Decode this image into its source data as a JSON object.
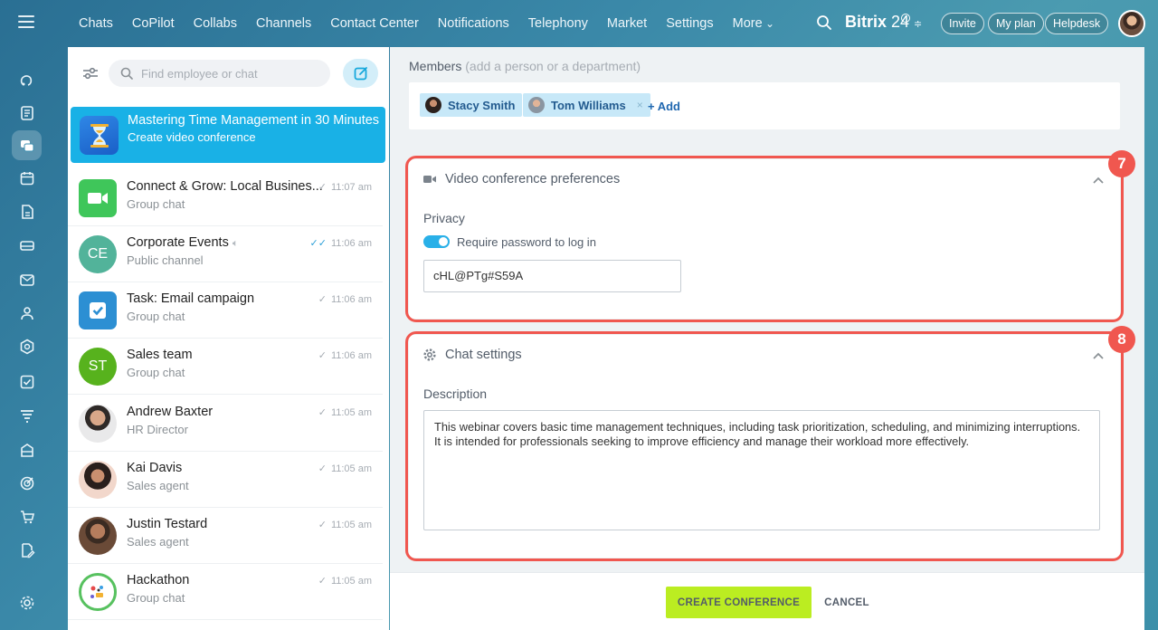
{
  "topbar": {
    "nav": [
      "Chats",
      "CoPilot",
      "Collabs",
      "Channels",
      "Contact Center",
      "Notifications",
      "Telephony",
      "Market",
      "Settings"
    ],
    "more_label": "More",
    "brand_name": "Bitrix",
    "brand_num": " 24",
    "invite_label": "Invite",
    "myplan_label": "My plan",
    "helpdesk_label": "Helpdesk"
  },
  "rail": {
    "icons": [
      "feed-icon",
      "news-icon",
      "chat-icon",
      "calendar-icon",
      "document-icon",
      "drive-icon",
      "mail-icon",
      "contacts-icon",
      "hexagon-icon",
      "tasks-icon",
      "funnel-icon",
      "building-icon",
      "target-icon",
      "cart-icon",
      "edit-doc-icon",
      "settings-icon"
    ]
  },
  "chatlist": {
    "search_placeholder": "Find employee or chat",
    "active": {
      "title": "Mastering Time Management in 30 Minutes",
      "subtitle": "Create video conference"
    },
    "items": [
      {
        "name": "Connect & Grow: Local Busines...",
        "sub": "Group chat",
        "time": "11:07 am",
        "initials": "",
        "check": "✓"
      },
      {
        "name": "Corporate Events",
        "sub": "Public channel",
        "time": "11:06 am",
        "initials": "CE",
        "check": "✓✓"
      },
      {
        "name": "Task: Email campaign",
        "sub": "Group chat",
        "time": "11:06 am",
        "initials": "",
        "check": "✓"
      },
      {
        "name": "Sales team",
        "sub": "Group chat",
        "time": "11:06 am",
        "initials": "ST",
        "check": "✓"
      },
      {
        "name": "Andrew Baxter",
        "sub": "HR Director",
        "time": "11:05 am",
        "initials": "",
        "check": "✓"
      },
      {
        "name": "Kai Davis",
        "sub": "Sales agent",
        "time": "11:05 am",
        "initials": "",
        "check": "✓"
      },
      {
        "name": "Justin Testard",
        "sub": "Sales agent",
        "time": "11:05 am",
        "initials": "",
        "check": "✓"
      },
      {
        "name": "Hackathon",
        "sub": "Group chat",
        "time": "11:05 am",
        "initials": "",
        "check": "✓"
      }
    ]
  },
  "members": {
    "label": "Members",
    "hint": "(add a person or a department)",
    "chips": [
      "Stacy Smith",
      "Tom Williams"
    ],
    "remove_glyph": "×",
    "add_label": "+ Add"
  },
  "video_prefs": {
    "title": "Video conference preferences",
    "privacy_label": "Privacy",
    "toggle_label": "Require password to log in",
    "password": "cHL@PTg#S59A",
    "badge": "7"
  },
  "chat_settings": {
    "title": "Chat settings",
    "description_label": "Description",
    "description": "This webinar covers basic time management techniques, including task prioritization, scheduling, and minimizing interruptions. It is intended for professionals seeking to improve efficiency and manage their workload more effectively.",
    "badge": "8"
  },
  "footer": {
    "create_label": "CREATE CONFERENCE",
    "cancel_label": "CANCEL"
  },
  "colors": {
    "accent": "#19b1e6",
    "highlight": "#f0574f",
    "create_button": "#bbed21"
  }
}
